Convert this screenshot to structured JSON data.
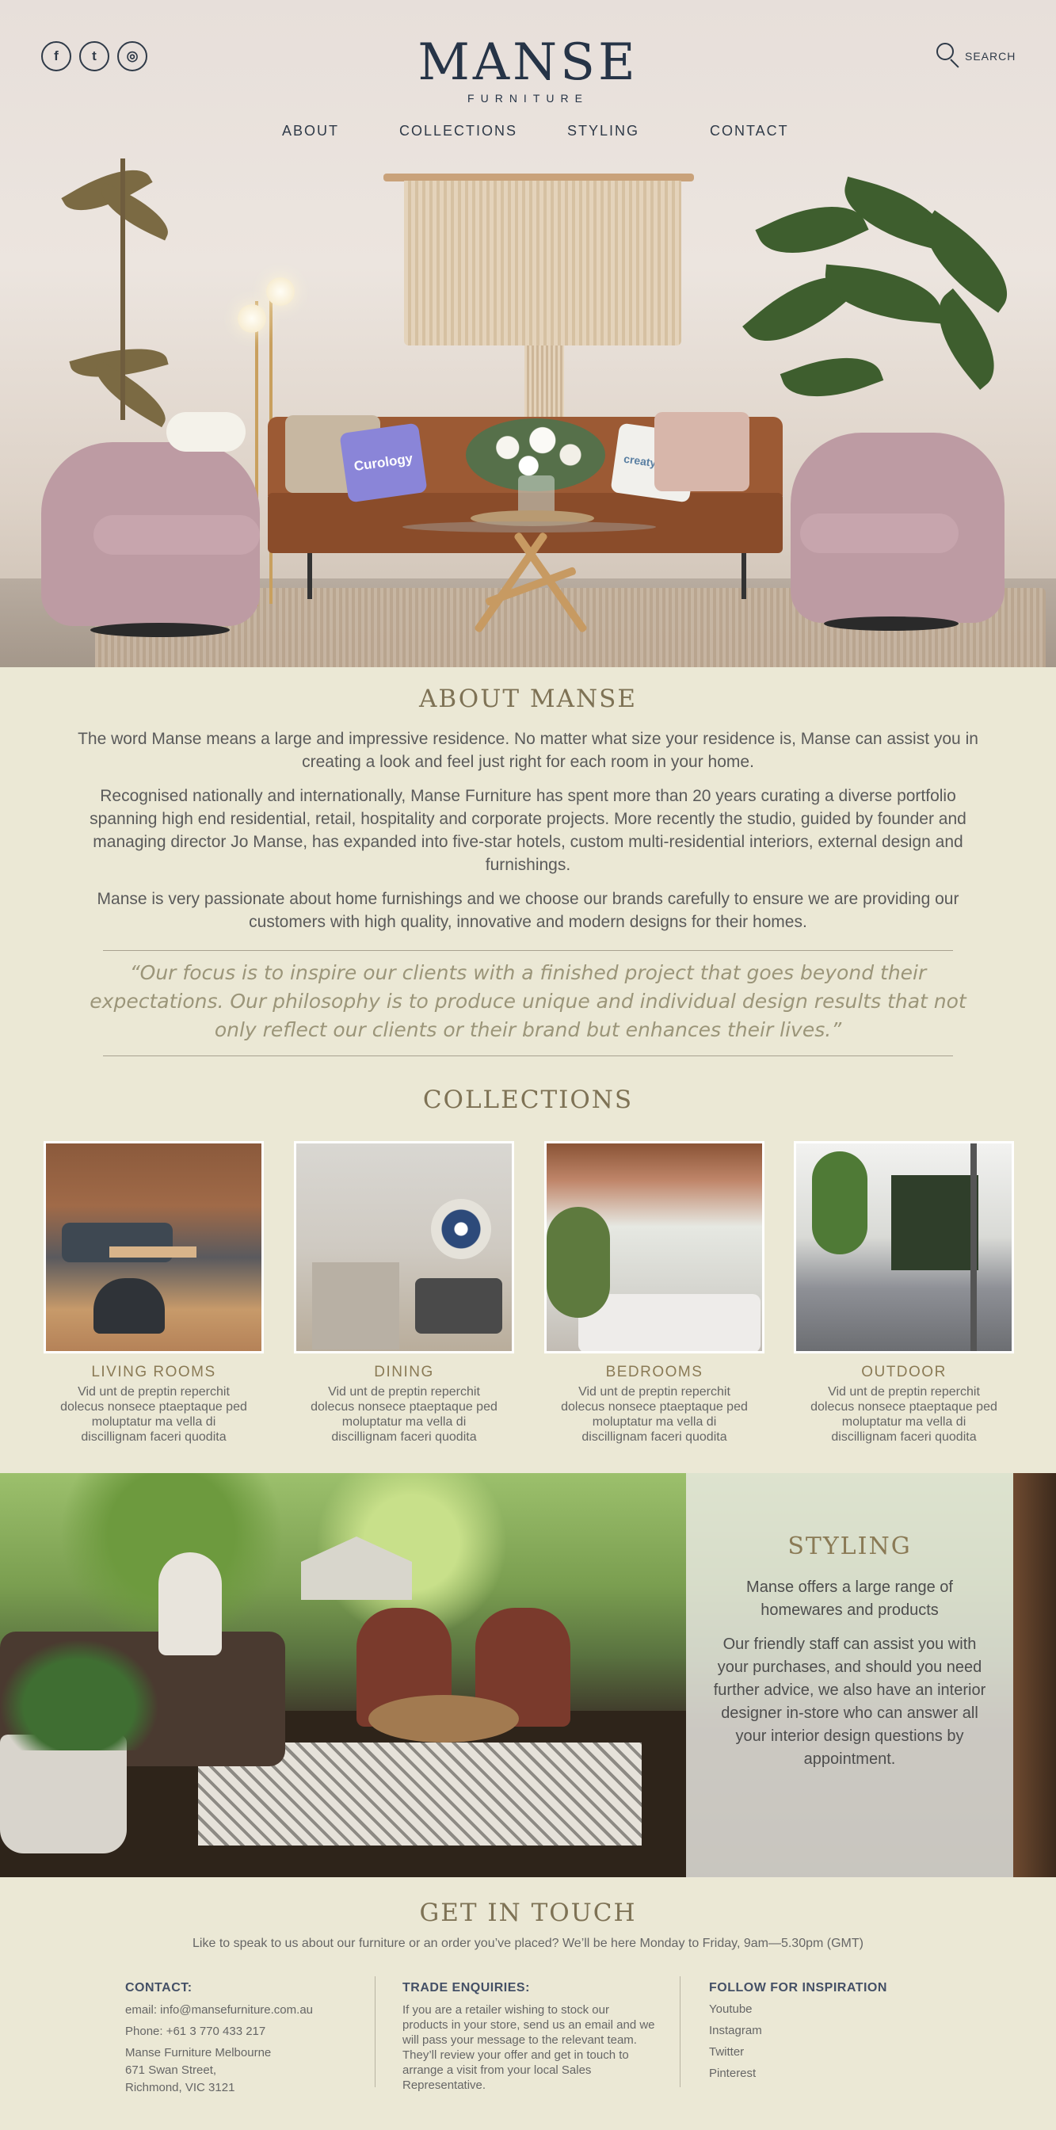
{
  "header": {
    "social": [
      {
        "label": "f",
        "icon": "facebook-icon"
      },
      {
        "label": "t",
        "icon": "twitter-icon"
      },
      {
        "label": "◎",
        "icon": "instagram-icon"
      }
    ],
    "logo_word": "MANSE",
    "logo_sub": "FURNITURE",
    "search_label": "SEARCH",
    "nav": [
      "ABOUT",
      "COLLECTIONS",
      "STYLING",
      "CONTACT"
    ]
  },
  "hero": {
    "pillow_left_text": "Curology",
    "pillow_right_text": "creatyoskin"
  },
  "about": {
    "title": "ABOUT MANSE",
    "p1": "The word Manse means a large and impressive residence. No matter what size your residence is, Manse can assist you in creating a look and feel just right for each room in your home.",
    "p2": "Recognised nationally and internationally, Manse Furniture has spent more than 20 years curating a diverse portfolio spanning high end residential, retail, hospitality and corporate projects. More recently the studio, guided by founder and managing director Jo Manse, has expanded into five-star hotels, custom multi-residential interiors, external design and furnishings.",
    "p3": "Manse is very passionate about home furnishings and we choose our brands carefully to ensure we are providing our customers with high quality, innovative and modern designs for their homes.",
    "quote": "“Our focus is to inspire our clients with a finished project that goes beyond their expectations. Our philosophy is to produce unique and individual design results that not only reflect our clients or their brand but enhances their lives.”"
  },
  "collections": {
    "title": "COLLECTIONS",
    "items": [
      {
        "title": "LIVING ROOMS",
        "desc": "Vid unt de preptin reperchit dolecus nonsece ptaeptaque ped moluptatur ma vella di discillignam faceri quodita"
      },
      {
        "title": "DINING",
        "desc": "Vid unt de preptin reperchit dolecus nonsece ptaeptaque ped moluptatur ma vella di discillignam faceri quodita"
      },
      {
        "title": "BEDROOMS",
        "desc": "Vid unt de preptin reperchit dolecus nonsece ptaeptaque ped moluptatur ma vella di discillignam faceri quodita"
      },
      {
        "title": "OUTDOOR",
        "desc": "Vid unt de preptin reperchit dolecus nonsece ptaeptaque ped moluptatur ma vella di discillignam faceri quodita"
      }
    ]
  },
  "styling": {
    "title": "STYLING",
    "p1": "Manse offers a large range of homewares and products",
    "p2": "Our friendly staff can assist you with your purchases, and should you need further advice, we also have an interior designer in-store who can answer all your interior design questions by appointment."
  },
  "contact": {
    "title": "GET IN TOUCH",
    "intro": "Like to speak to us about our furniture or an order you’ve placed? We’ll be here Monday to Friday, 9am—5.30pm (GMT)",
    "col1": {
      "heading": "CONTACT:",
      "email": "email: info@mansefurniture.com.au",
      "phone": "Phone: +61 3 770 433 217",
      "address1": "Manse Furniture Melbourne",
      "address2": "671 Swan Street,",
      "address3": "Richmond, VIC 3121"
    },
    "col2": {
      "heading": "TRADE ENQUIRIES:",
      "text": "If you are a retailer wishing to stock our products in your store, send us an email and we will pass your message to the relevant team. They’ll review your offer and get in touch to arrange a visit from your local Sales Representative."
    },
    "col3": {
      "heading": "FOLLOW FOR INSPIRATION",
      "links": [
        "Youtube",
        "Instagram",
        "Twitter",
        "Pinterest"
      ]
    }
  },
  "colors": {
    "page_bg": "#ebe8d5",
    "navy": "#263447",
    "heading_gold": "#7e7255"
  }
}
